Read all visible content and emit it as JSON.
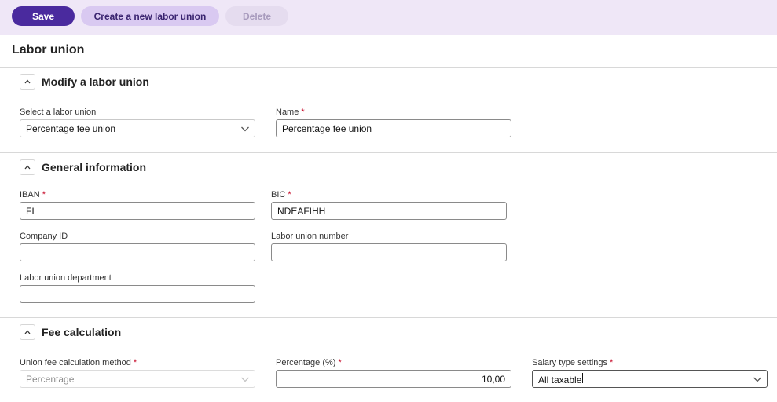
{
  "toolbar": {
    "save_label": "Save",
    "create_label": "Create a new labor union",
    "delete_label": "Delete"
  },
  "page": {
    "title": "Labor union"
  },
  "modify_section": {
    "title": "Modify a labor union",
    "select_label": "Select a labor union",
    "select_value": "Percentage fee union",
    "name_label": "Name",
    "name_value": "Percentage fee union"
  },
  "general_section": {
    "title": "General information",
    "iban_label": "IBAN",
    "iban_value": "FI",
    "bic_label": "BIC",
    "bic_value": "NDEAFIHH",
    "company_id_label": "Company ID",
    "company_id_value": "",
    "union_number_label": "Labor union number",
    "union_number_value": "",
    "department_label": "Labor union department",
    "department_value": ""
  },
  "fee_section": {
    "title": "Fee calculation",
    "method_label": "Union fee calculation method",
    "method_value": "Percentage",
    "percentage_label": "Percentage (%)",
    "percentage_value": "10,00",
    "salary_label": "Salary type settings",
    "salary_value": "All taxable"
  },
  "required_marker": "*",
  "colors": {
    "primary": "#4a2a9e",
    "secondary": "#d9c9f1",
    "toolbar_bg": "#efe7f7",
    "required": "#c8102e"
  }
}
